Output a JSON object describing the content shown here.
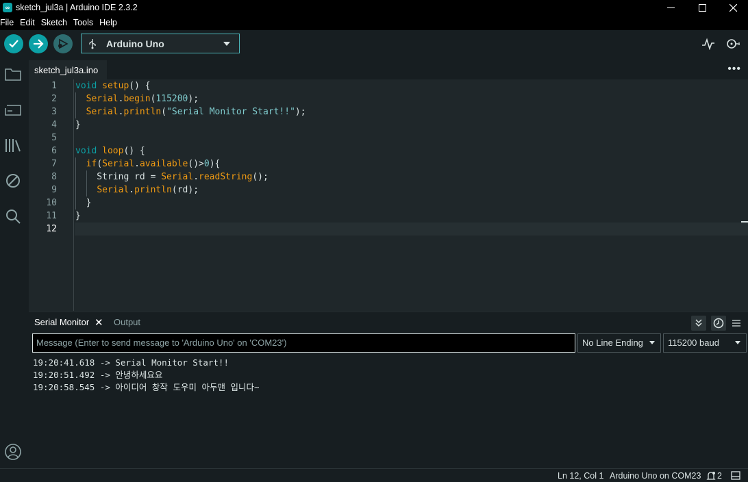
{
  "window": {
    "title": "sketch_jul3a | Arduino IDE 2.3.2"
  },
  "menu": [
    "File",
    "Edit",
    "Sketch",
    "Tools",
    "Help"
  ],
  "toolbar": {
    "board": "Arduino Uno"
  },
  "editor": {
    "tab": "sketch_jul3a.ino",
    "line_numbers": [
      "1",
      "2",
      "3",
      "4",
      "5",
      "6",
      "7",
      "8",
      "9",
      "10",
      "11",
      "12"
    ],
    "current_line": "12",
    "code": {
      "l1": [
        "void",
        " ",
        "setup",
        "() {"
      ],
      "l2": [
        "  ",
        "Serial",
        ".",
        "begin",
        "(",
        "115200",
        ");"
      ],
      "l3": [
        "  ",
        "Serial",
        ".",
        "println",
        "(",
        "\"Serial Monitor Start!!\"",
        ");"
      ],
      "l4": [
        "}"
      ],
      "l6": [
        "void",
        " ",
        "loop",
        "() {"
      ],
      "l7": [
        "  ",
        "if",
        "(",
        "Serial",
        ".",
        "available",
        "()>",
        "0",
        "){"
      ],
      "l8": [
        "    String rd = ",
        "Serial",
        ".",
        "readString",
        "();"
      ],
      "l9": [
        "    ",
        "Serial",
        ".",
        "println",
        "(rd);"
      ],
      "l10": [
        "  }"
      ],
      "l11": [
        "}"
      ]
    }
  },
  "panel": {
    "serial_tab": "Serial Monitor",
    "output_tab": "Output",
    "message_placeholder": "Message (Enter to send message to 'Arduino Uno' on 'COM23')",
    "line_ending": "No Line Ending",
    "baud": "115200 baud",
    "lines": [
      "19:20:41.618 -> Serial Monitor Start!!",
      "19:20:51.492 -> 안녕하세요요",
      "19:20:58.545 -> 아이디어 창작 도우미 아두맨 입니다~"
    ]
  },
  "status": {
    "position": "Ln 12, Col 1",
    "board": "Arduino Uno on COM23",
    "notifications": "2"
  },
  "colors": {
    "accent": "#0ca1a6",
    "keyword": "#0ca1a6",
    "function": "#f39c12",
    "literal": "#7fcbcd"
  }
}
